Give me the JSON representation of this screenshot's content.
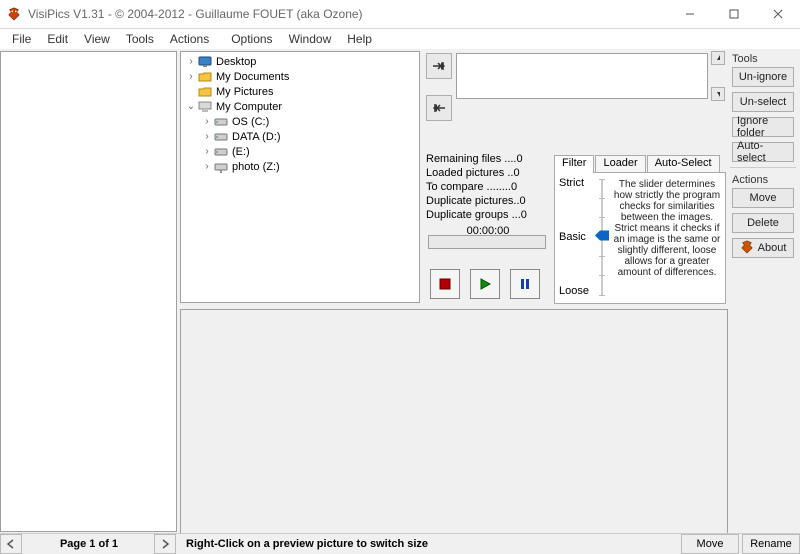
{
  "window": {
    "title": "VisiPics V1.31 - © 2004-2012 - Guillaume FOUET (aka Ozone)"
  },
  "menu": {
    "file": "File",
    "edit": "Edit",
    "view": "View",
    "tools": "Tools",
    "actions": "Actions",
    "options": "Options",
    "window": "Window",
    "help": "Help"
  },
  "tree": {
    "items": [
      {
        "level": 1,
        "expander": ">",
        "icon": "desktop-icon",
        "label": "Desktop"
      },
      {
        "level": 1,
        "expander": ">",
        "icon": "folder-icon",
        "label": "My Documents"
      },
      {
        "level": 1,
        "expander": "",
        "icon": "folder-icon",
        "label": "My Pictures"
      },
      {
        "level": 1,
        "expander": "v",
        "icon": "computer-icon",
        "label": "My Computer"
      },
      {
        "level": 2,
        "expander": ">",
        "icon": "disk-icon",
        "label": "OS (C:)"
      },
      {
        "level": 2,
        "expander": ">",
        "icon": "disk-icon",
        "label": "DATA (D:)"
      },
      {
        "level": 2,
        "expander": ">",
        "icon": "disk-icon",
        "label": "(E:)"
      },
      {
        "level": 2,
        "expander": ">",
        "icon": "netdrive-icon",
        "label": "photo (Z:)"
      }
    ]
  },
  "stats": {
    "remaining": "Remaining files ....0",
    "loaded": "Loaded pictures ..0",
    "compare": "To compare ........0",
    "duppic": "Duplicate pictures..0",
    "dupgrp": "Duplicate groups ...0",
    "timer": "00:00:00"
  },
  "tabs": {
    "filter": "Filter",
    "loader": "Loader",
    "autoselect": "Auto-Select"
  },
  "filter": {
    "strict": "Strict",
    "basic": "Basic",
    "loose": "Loose",
    "desc": "The slider determines how strictly the program checks for similarities between the images. Strict means it checks if an image is the same or slightly different, loose allows for a greater amount of differences."
  },
  "tools": {
    "heading": "Tools",
    "unignore": "Un-ignore",
    "unselect": "Un-select",
    "ignorefolder": "Ignore folder",
    "autoselect": "Auto-select"
  },
  "actions": {
    "heading": "Actions",
    "move": "Move",
    "delete": "Delete",
    "about": "About"
  },
  "status": {
    "page": "Page 1 of 1",
    "hint": "Right-Click on a preview picture to switch size",
    "move": "Move",
    "rename": "Rename"
  }
}
